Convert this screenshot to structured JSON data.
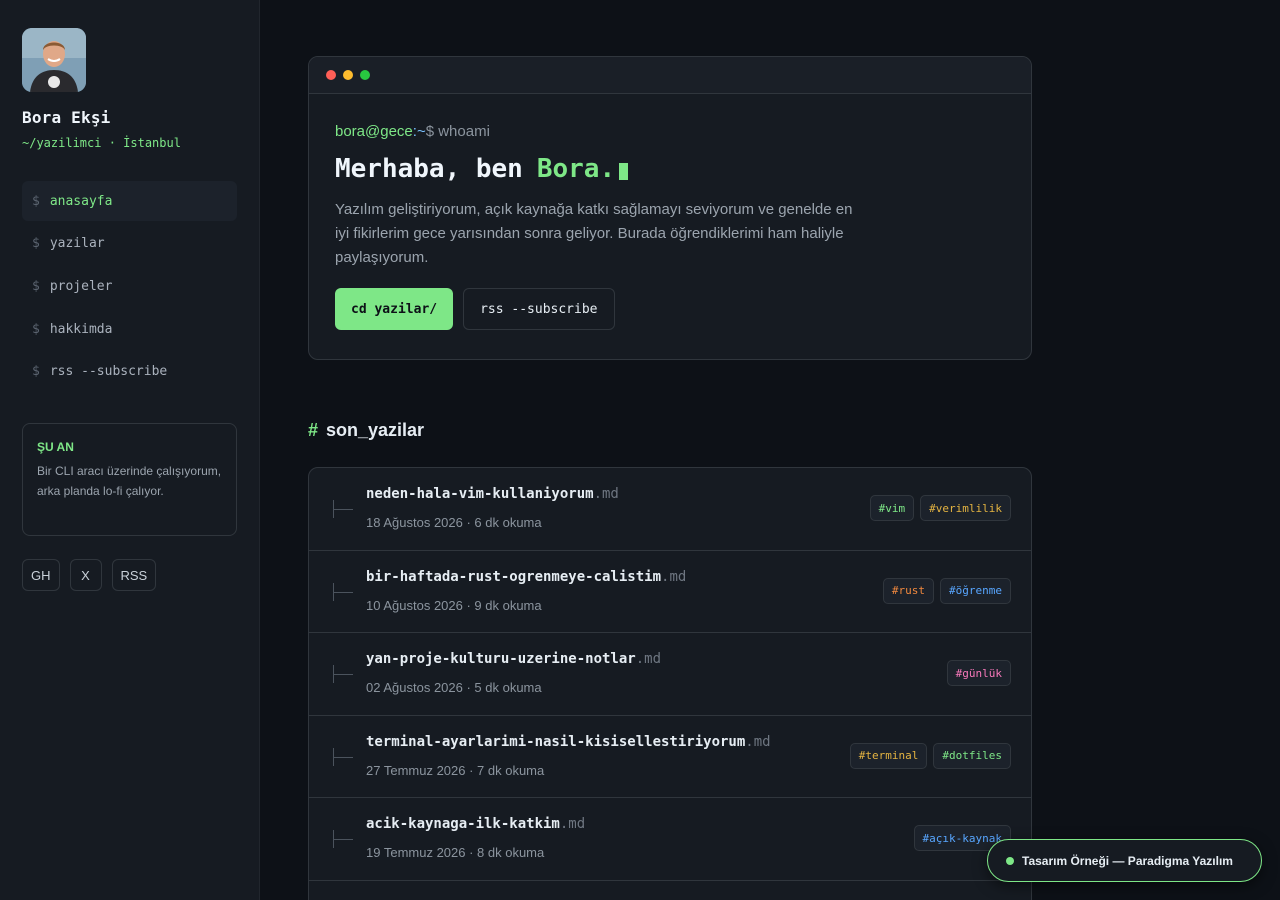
{
  "profile": {
    "name": "Bora Ekşi",
    "subtitle": "~/yazilimci · İstanbul"
  },
  "nav": {
    "items": [
      {
        "label": "anasayfa",
        "active": true
      },
      {
        "label": "yazilar",
        "active": false
      },
      {
        "label": "projeler",
        "active": false
      },
      {
        "label": "hakkimda",
        "active": false
      },
      {
        "label": "rss --subscribe",
        "active": false
      }
    ]
  },
  "now": {
    "title": "ŞU AN",
    "text": "Bir CLI aracı üzerinde çalışıyorum, arka planda lo-fi çalıyor."
  },
  "socials": [
    "GH",
    "X",
    "RSS"
  ],
  "hero": {
    "prompt_user": "bora@gece",
    "prompt_path": ":~",
    "prompt_cmd": "$ whoami",
    "title_prefix": "Merhaba, ben",
    "title_name": "Bora.",
    "description": "Yazılım geliştiriyorum, açık kaynağa katkı sağlamayı seviyorum ve genelde en iyi fikirlerim gece yarısından sonra geliyor. Burada öğrendiklerimi ham haliyle paylaşıyorum.",
    "primary_button": "cd yazilar/",
    "secondary_button": "rss --subscribe"
  },
  "section": {
    "hash": "#",
    "title": "son_yazilar"
  },
  "posts": [
    {
      "slug": "neden-hala-vim-kullaniyorum",
      "ext": ".md",
      "meta": "18 Ağustos 2026 · 6 dk okuma",
      "tags": [
        {
          "label": "#vim",
          "color": "#7ee787"
        },
        {
          "label": "#verimlilik",
          "color": "#e3b341"
        }
      ]
    },
    {
      "slug": "bir-haftada-rust-ogrenmeye-calistim",
      "ext": ".md",
      "meta": "10 Ağustos 2026 · 9 dk okuma",
      "tags": [
        {
          "label": "#rust",
          "color": "#f0883e"
        },
        {
          "label": "#öğrenme",
          "color": "#58a6ff"
        }
      ]
    },
    {
      "slug": "yan-proje-kulturu-uzerine-notlar",
      "ext": ".md",
      "meta": "02 Ağustos 2026 · 5 dk okuma",
      "tags": [
        {
          "label": "#günlük",
          "color": "#f778ba"
        }
      ]
    },
    {
      "slug": "terminal-ayarlarimi-nasil-kisisellestiriyorum",
      "ext": ".md",
      "meta": "27 Temmuz 2026 · 7 dk okuma",
      "tags": [
        {
          "label": "#terminal",
          "color": "#e3b341"
        },
        {
          "label": "#dotfiles",
          "color": "#7ee787"
        }
      ]
    },
    {
      "slug": "acik-kaynaga-ilk-katkim",
      "ext": ".md",
      "meta": "19 Temmuz 2026 · 8 dk okuma",
      "tags": [
        {
          "label": "#açık-kaynak",
          "color": "#58a6ff"
        }
      ]
    }
  ],
  "badge": {
    "label": "Tasarım Örneği — Paradigma Yazılım"
  },
  "colors": {
    "accent": "#7ee787",
    "background": "#0d1117",
    "surface": "#161b22"
  },
  "icons": {
    "window_dots": [
      "red-dot-icon",
      "yellow-dot-icon",
      "green-dot-icon"
    ]
  }
}
